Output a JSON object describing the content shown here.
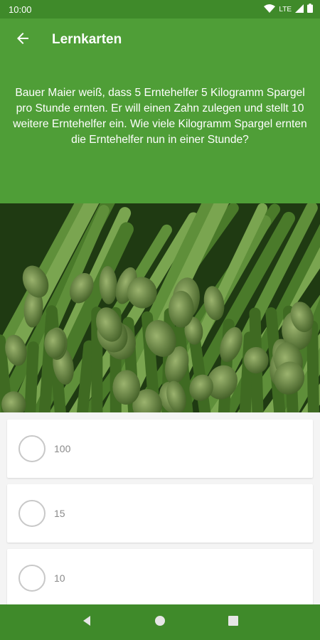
{
  "status_bar": {
    "time": "10:00",
    "network": "LTE"
  },
  "app_bar": {
    "title": "Lernkarten",
    "back_icon": "arrow-back-icon"
  },
  "question": {
    "text": "Bauer Maier weiß, dass 5 Erntehelfer 5 Kilogramm Spargel pro Stunde ernten. Er will einen Zahn zulegen und stellt 10 weitere Erntehelfer ein. Wie viele Kilogramm Spargel ernten die Erntehelfer nun in einer Stunde?"
  },
  "answers": [
    {
      "label": "100"
    },
    {
      "label": "15"
    },
    {
      "label": "10"
    }
  ],
  "nav_bar": {
    "icons": [
      "back-triangle-icon",
      "home-circle-icon",
      "recents-square-icon"
    ]
  },
  "colors": {
    "primary": "#4f9e37",
    "primary_dark": "#3f8a2a",
    "background": "#f4f4f4"
  }
}
